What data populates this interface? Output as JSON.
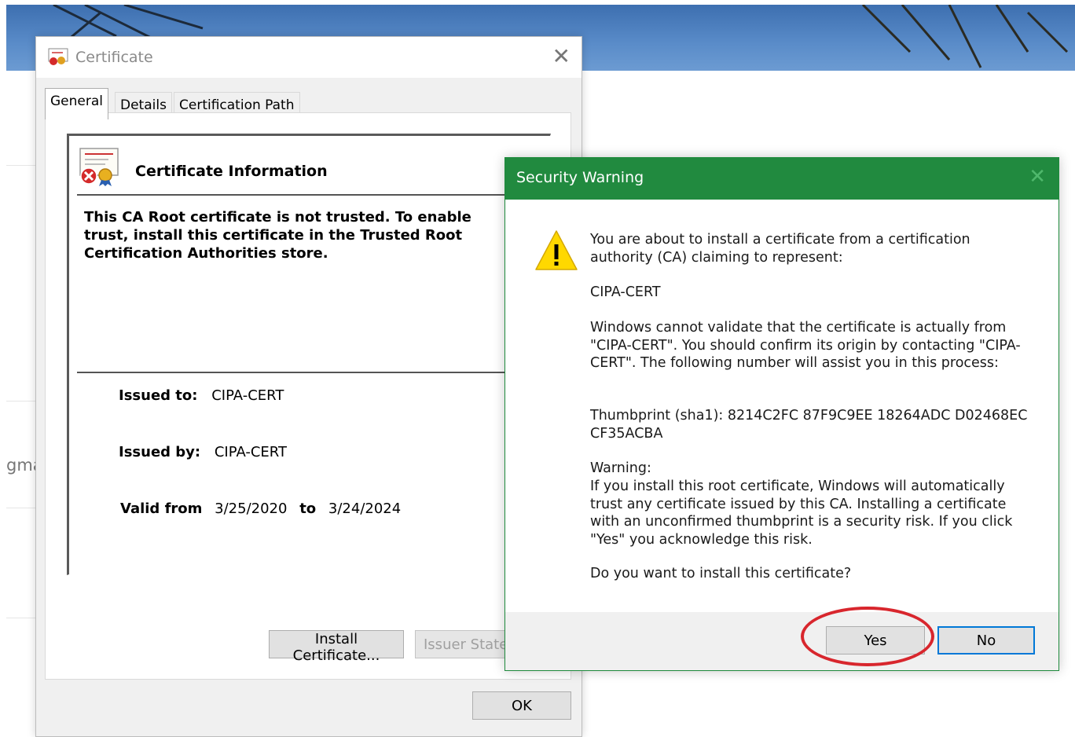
{
  "background": {
    "partial_text": "gma",
    "accent_color": "#218a3f",
    "annotation_color": "#d8262d"
  },
  "certificate_window": {
    "title": "Certificate",
    "close_icon": "close-icon",
    "tabs": [
      {
        "label": "General",
        "active": true
      },
      {
        "label": "Details",
        "active": false
      },
      {
        "label": "Certification Path",
        "active": false
      }
    ],
    "info": {
      "heading": "Certificate Information",
      "icon": "certificate-error-icon",
      "warning": "This CA Root certificate is not trusted. To enable trust, install this certificate in the Trusted Root Certification Authorities store.",
      "issued_to_label": "Issued to:",
      "issued_to": "CIPA-CERT",
      "issued_by_label": "Issued by:",
      "issued_by": "CIPA-CERT",
      "valid_from_label": "Valid from",
      "valid_from": "3/25/2020",
      "to_label": "to",
      "valid_to": "3/24/2024"
    },
    "buttons": {
      "install": "Install Certificate...",
      "issuer_statement": "Issuer Statement",
      "ok": "OK"
    }
  },
  "security_warning": {
    "title": "Security Warning",
    "icon": "warning-triangle-icon",
    "intro": "You are about to install a certificate from a certification authority (CA) claiming to represent:",
    "cert_name": "CIPA-CERT",
    "validation": "Windows cannot validate that the certificate is actually from \"CIPA-CERT\". You should confirm its origin by contacting \"CIPA-CERT\". The following number will assist you in this process:",
    "thumbprint": "Thumbprint (sha1): 8214C2FC 87F9C9EE 18264ADC D02468EC CF35ACBA",
    "warning_label": "Warning:",
    "warning_text": "If you install this root certificate, Windows will automatically trust any certificate issued by this CA. Installing a certificate with an unconfirmed thumbprint is a security risk. If you click \"Yes\" you acknowledge this risk.",
    "question": "Do you want to install this certificate?",
    "yes": "Yes",
    "no": "No"
  }
}
